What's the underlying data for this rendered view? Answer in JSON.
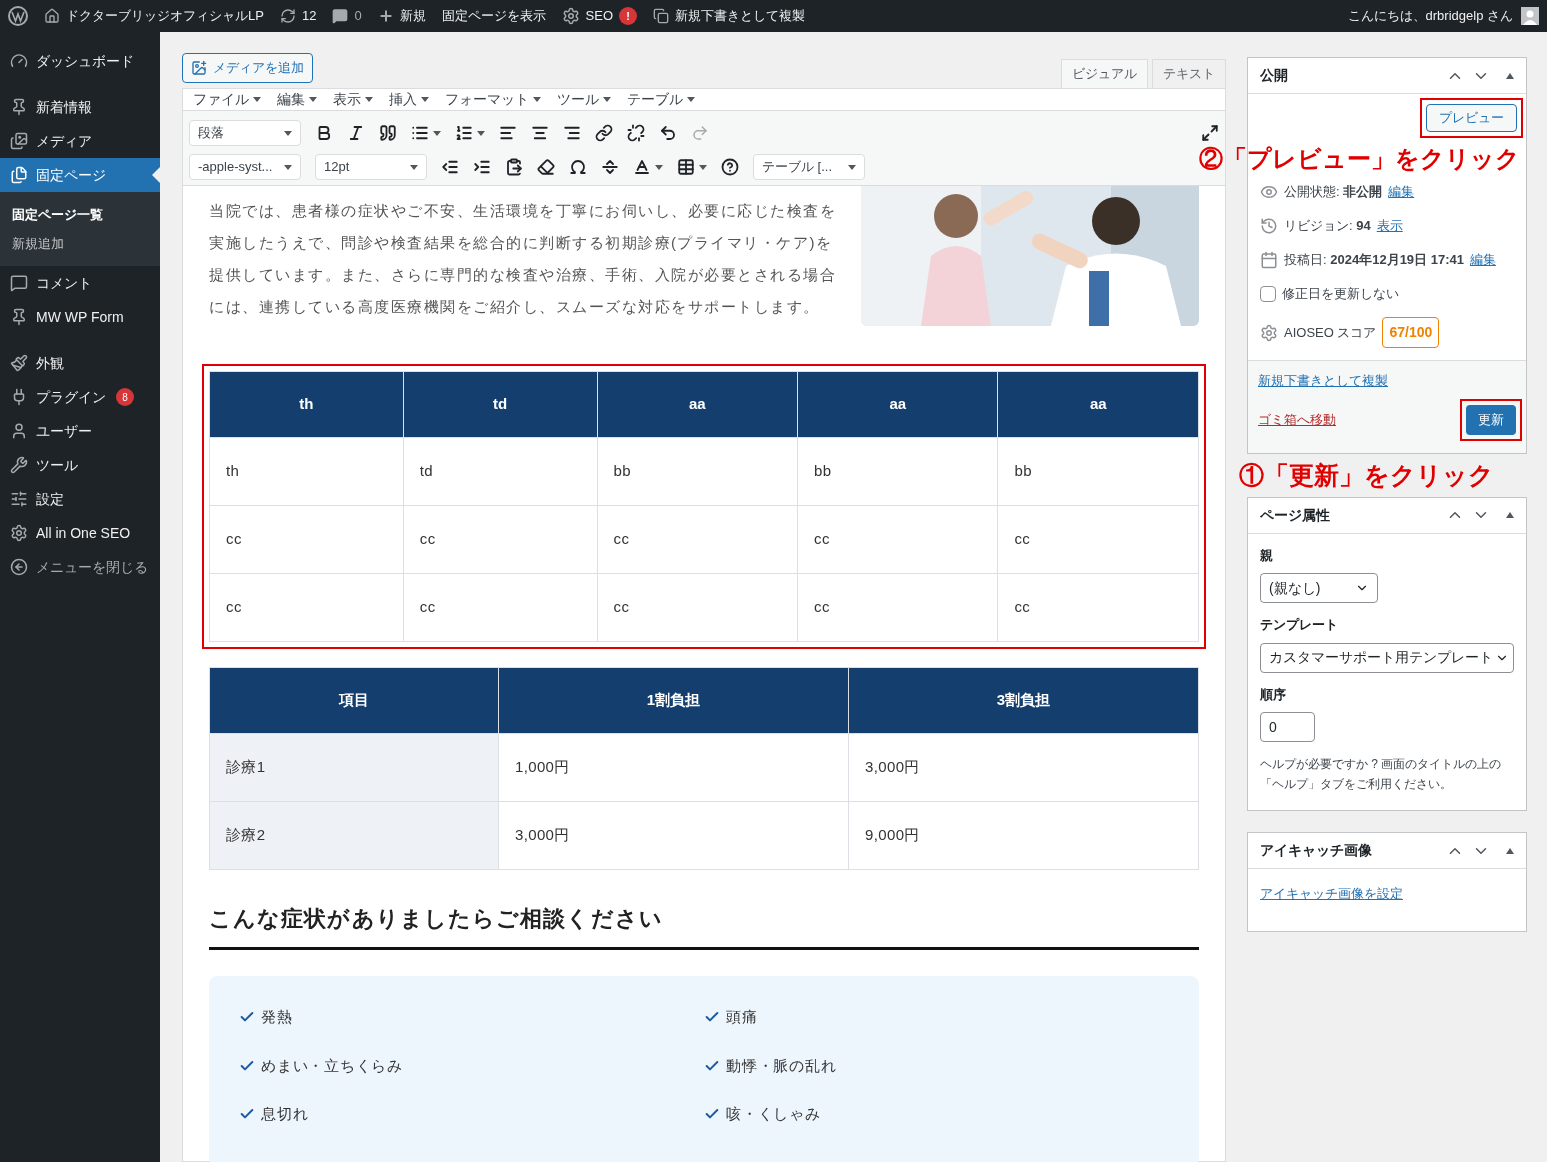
{
  "admin_bar": {
    "site": "ドクターブリッジオフィシャルLP",
    "updates": "12",
    "comments": "0",
    "new": "新規",
    "view_page": "固定ページを表示",
    "seo": "SEO",
    "seo_badge": "!",
    "duplicate": "新規下書きとして複製",
    "greeting": "こんにちは、drbridgelp さん"
  },
  "sidebar": {
    "groups": [
      {
        "items": [
          {
            "label": "ダッシュボード",
            "selected": false
          }
        ]
      },
      {
        "items": [
          {
            "label": "新着情報",
            "selected": false
          },
          {
            "label": "メディア",
            "selected": false
          },
          {
            "label": "固定ページ",
            "selected": true,
            "children": [
              {
                "label": "固定ページ一覧",
                "selected": true
              },
              {
                "label": "新規追加",
                "selected": false
              }
            ]
          },
          {
            "label": "コメント",
            "selected": false
          },
          {
            "label": "MW WP Form",
            "selected": false
          }
        ]
      },
      {
        "items": [
          {
            "label": "外観",
            "selected": false
          },
          {
            "label": "プラグイン",
            "selected": false,
            "badge": "8"
          },
          {
            "label": "ユーザー",
            "selected": false
          },
          {
            "label": "ツール",
            "selected": false
          },
          {
            "label": "設定",
            "selected": false
          },
          {
            "label": "All in One SEO",
            "selected": false
          },
          {
            "label": "メニューを閉じる",
            "selected": false,
            "kind": "collapse"
          }
        ]
      }
    ]
  },
  "editor": {
    "media_button": "メディアを追加",
    "tabs": [
      {
        "label": "ビジュアル",
        "selected": true
      },
      {
        "label": "テキスト",
        "selected": false
      }
    ],
    "menu": [
      "ファイル",
      "編集",
      "表示",
      "挿入",
      "フォーマット",
      "ツール",
      "テーブル"
    ],
    "format_select": "段落",
    "font_select": "-apple-syst...",
    "size_select": "12pt",
    "table_select": "テーブル [...",
    "content": {
      "paragraph": "当院では、患者様の症状やご不安、生活環境を丁寧にお伺いし、必要に応じた検査を実施したうえで、問診や検査結果を総合的に判断する初期診療(プライマリ・ケア)を提供しています。また、さらに専門的な検査や治療、手術、入院が必要とされる場合には、連携している高度医療機関をご紹介し、スムーズな対応をサポートします。",
      "tables": [
        {
          "highlighted": true,
          "shaded_first_column": false,
          "columns": [
            "th",
            "td",
            "aa",
            "aa",
            "aa"
          ],
          "rows": [
            [
              "th",
              "td",
              "bb",
              "bb",
              "bb"
            ],
            [
              "cc",
              "cc",
              "cc",
              "cc",
              "cc"
            ],
            [
              "cc",
              "cc",
              "cc",
              "cc",
              "cc"
            ]
          ]
        },
        {
          "highlighted": false,
          "shaded_first_column": true,
          "columns": [
            "項目",
            "1割負担",
            "3割負担"
          ],
          "rows": [
            [
              "診療1",
              "1,000円",
              "3,000円"
            ],
            [
              "診療2",
              "3,000円",
              "9,000円"
            ]
          ]
        }
      ],
      "heading": "こんな症状がありましたらご相談ください",
      "symptoms": [
        "発熱",
        "頭痛",
        "めまい・立ちくらみ",
        "動悸・脈の乱れ",
        "息切れ",
        "咳・くしゃみ"
      ]
    }
  },
  "publish": {
    "title": "公開",
    "preview": {
      "label": "プレビュー",
      "highlighted": true
    },
    "preview_note": "②「プレビュー」をクリック",
    "rows": [
      {
        "kind": "status",
        "label": "公開状態:",
        "value": "非公開",
        "link": "編集"
      },
      {
        "kind": "revision",
        "label": "リビジョン:",
        "value": "94",
        "link": "表示"
      },
      {
        "kind": "date",
        "label": "投稿日:",
        "value": "2024年12月19日 17:41",
        "link": "編集"
      },
      {
        "kind": "checkbox",
        "label": "修正日を更新しない",
        "checked": false
      },
      {
        "kind": "score",
        "label": "AIOSEO スコア",
        "value": "67/100"
      }
    ],
    "duplicate_link": "新規下書きとして複製",
    "trash_link": "ゴミ箱へ移動",
    "update": {
      "label": "更新",
      "highlighted": true
    },
    "update_note": "①「更新」をクリック"
  },
  "page_attributes": {
    "title": "ページ属性",
    "parent_label": "親",
    "parent_value": "(親なし)",
    "template_label": "テンプレート",
    "template_value": "カスタマーサポート用テンプレート",
    "order_label": "順序",
    "order_value": "0",
    "help": "ヘルプが必要ですか ? 画面のタイトルの上の「ヘルプ」タブをご利用ください。"
  },
  "featured_image": {
    "title": "アイキャッチ画像",
    "link": "アイキャッチ画像を設定"
  }
}
